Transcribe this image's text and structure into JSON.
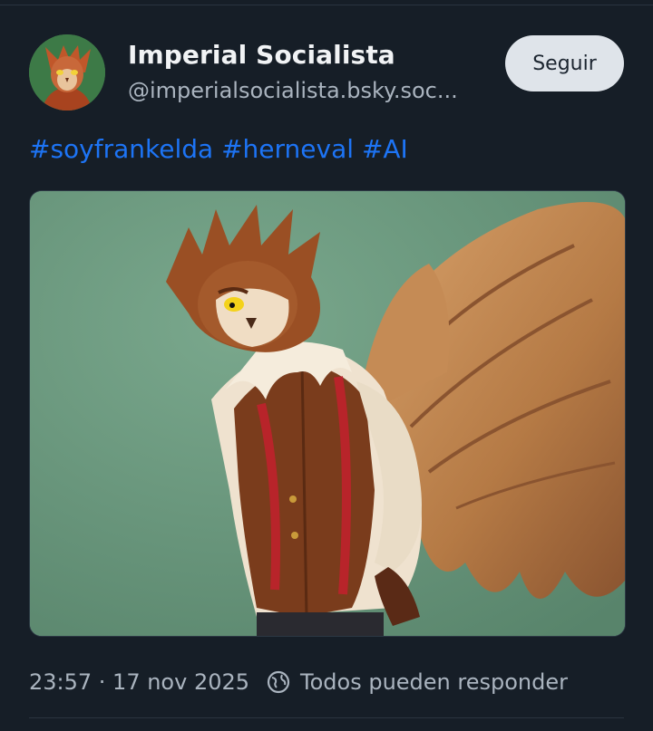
{
  "post": {
    "author": {
      "display_name": "Imperial Socialista",
      "handle": "@imperialsocialista.bsky.soc..."
    },
    "follow_label": "Seguir",
    "hashtags": [
      "#soyfrankelda",
      "#herneval",
      "#AI"
    ],
    "timestamp": "23:57 · 17 nov 2025",
    "reply_setting": "Todos pueden responder"
  },
  "colors": {
    "background": "#161e27",
    "hashtag": "#1d74f5",
    "follow_button_bg": "#dfe4ea",
    "muted_text": "#aab4bf"
  },
  "icons": {
    "reply_setting": "earth-icon"
  }
}
